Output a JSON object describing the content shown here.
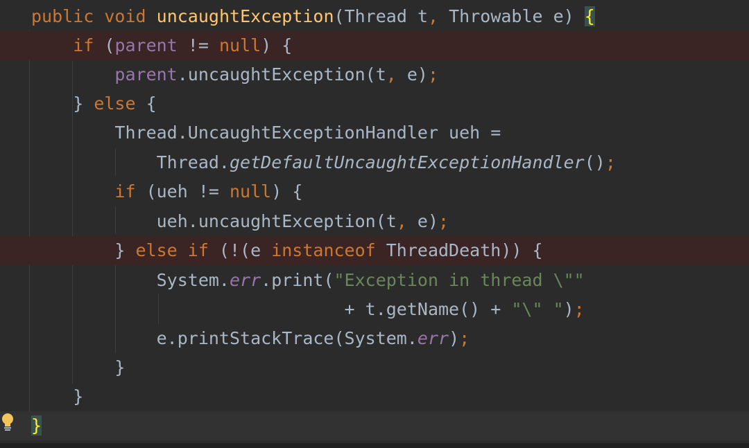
{
  "editor": {
    "language": "Java",
    "colors": {
      "background": "#2b2b2b",
      "keyword": "#cc7832",
      "method_declaration": "#ffc66d",
      "field": "#9876aa",
      "string": "#6a8759",
      "default_text": "#a9b7c6",
      "breakpoint_line": "#3a2424",
      "brace_match": "#ffef28"
    },
    "lines": [
      "public void uncaughtException(Thread t, Throwable e) {",
      "if (parent != null) {",
      "parent.uncaughtException(t, e);",
      "} else {",
      "Thread.UncaughtExceptionHandler ueh =",
      "Thread.getDefaultUncaughtExceptionHandler();",
      "if (ueh != null) {",
      "ueh.uncaughtException(t, e);",
      "} else if (!(e instanceof ThreadDeath)) {",
      "System.err.print(\"Exception in thread \\\"\"",
      "+ t.getName() + \"\\\" \");",
      "e.printStackTrace(System.err);",
      "}",
      "}",
      "}"
    ],
    "breakpoint_lines": [
      2,
      9
    ],
    "intention_icon": "lightbulb-icon"
  }
}
